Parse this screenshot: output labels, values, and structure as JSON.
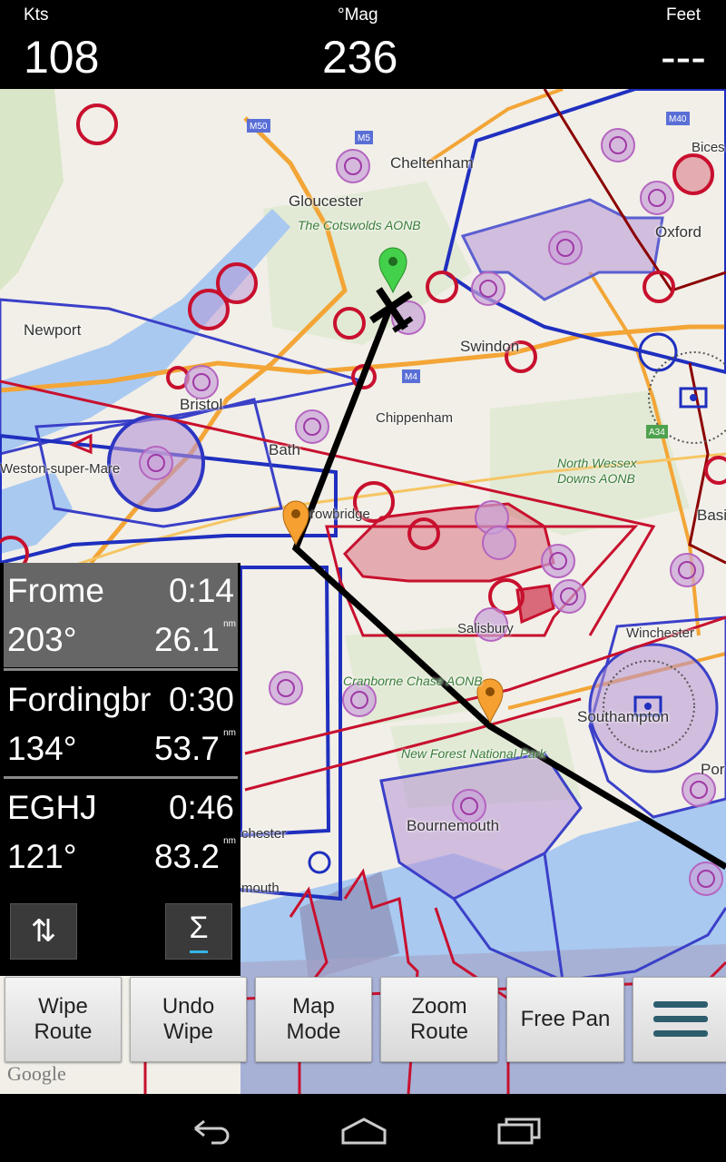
{
  "topbar": {
    "speed_label": "Kts",
    "speed_value": "108",
    "heading_label": "°Mag",
    "heading_value": "236",
    "altitude_label": "Feet",
    "altitude_value": "---"
  },
  "map": {
    "labels": {
      "cheltenham": "Cheltenham",
      "gloucester": "Gloucester",
      "cotswolds": "The Cotswolds AONB",
      "oxford": "Oxford",
      "bicester": "Bices",
      "newport": "Newport",
      "swindon": "Swindon",
      "bristol": "Bristol",
      "chippenham": "Chippenham",
      "bath": "Bath",
      "weston": "Weston-super-Mare",
      "trowbridge": "rowbridge",
      "north_wessex": "North Wessex\nDowns AONB",
      "basingstoke": "Basi",
      "salisbury": "Salisbury",
      "winchester": "Winchester",
      "cranborne": "Cranborne Chase AONB",
      "southampton": "Southampton",
      "new_forest": "New Forest National Park",
      "portsmouth": "Por",
      "bournemouth": "Bournemouth",
      "dorchester": "chester",
      "weymouth": "mouth",
      "m50": "M50",
      "m5": "M5",
      "m40": "M40",
      "m4": "M4",
      "a34": "A34"
    },
    "attribution": "Google"
  },
  "waypoints": [
    {
      "name": "Frome",
      "time": "0:14",
      "bearing": "203°",
      "distance": "26.1",
      "unit": "nm"
    },
    {
      "name": "Fordingbr",
      "time": "0:30",
      "bearing": "134°",
      "distance": "53.7",
      "unit": "nm"
    },
    {
      "name": "EGHJ",
      "time": "0:46",
      "bearing": "121°",
      "distance": "83.2",
      "unit": "nm"
    }
  ],
  "panel_buttons": {
    "swap_symbol": "⇅",
    "sum_symbol": "Σ"
  },
  "buttons": {
    "wipe_route": "Wipe\nRoute",
    "undo_wipe": "Undo\nWipe",
    "map_mode": "Map\nMode",
    "zoom_route": "Zoom\nRoute",
    "free_pan": "Free Pan",
    "menu_icon": "hamburger-menu-icon"
  },
  "colors": {
    "restricted_red": "#c8102e",
    "airspace_blue": "#1f2fbf",
    "route_black": "#000000",
    "zone_purple": "#c9a2d8",
    "menu_teal": "#2e5d6e"
  }
}
